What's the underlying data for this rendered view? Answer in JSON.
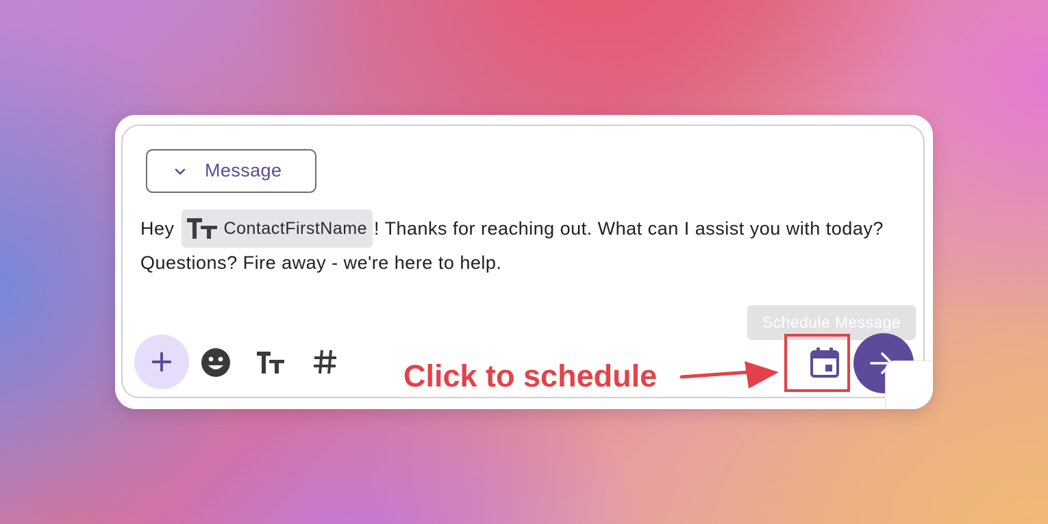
{
  "composer": {
    "mode_dropdown": {
      "label": "Message"
    },
    "message": {
      "prefix": "Hey ",
      "variable": "ContactFirstName",
      "suffix": "! Thanks for reaching out. What can I assist you with today? Questions? Fire away - we're here to help."
    },
    "tooltip": "Schedule Message",
    "toolbar": {
      "icons": [
        "plus-icon",
        "emoji-icon",
        "text-format-icon",
        "hashtag-icon",
        "calendar-icon",
        "arrow-right-icon"
      ]
    }
  },
  "annotation": {
    "text": "Click to schedule",
    "color": "#e3424a"
  },
  "colors": {
    "accent": "#5d4a9b",
    "accent_light": "#e6ddfb",
    "tooltip_bg": "#e2e2e4"
  }
}
